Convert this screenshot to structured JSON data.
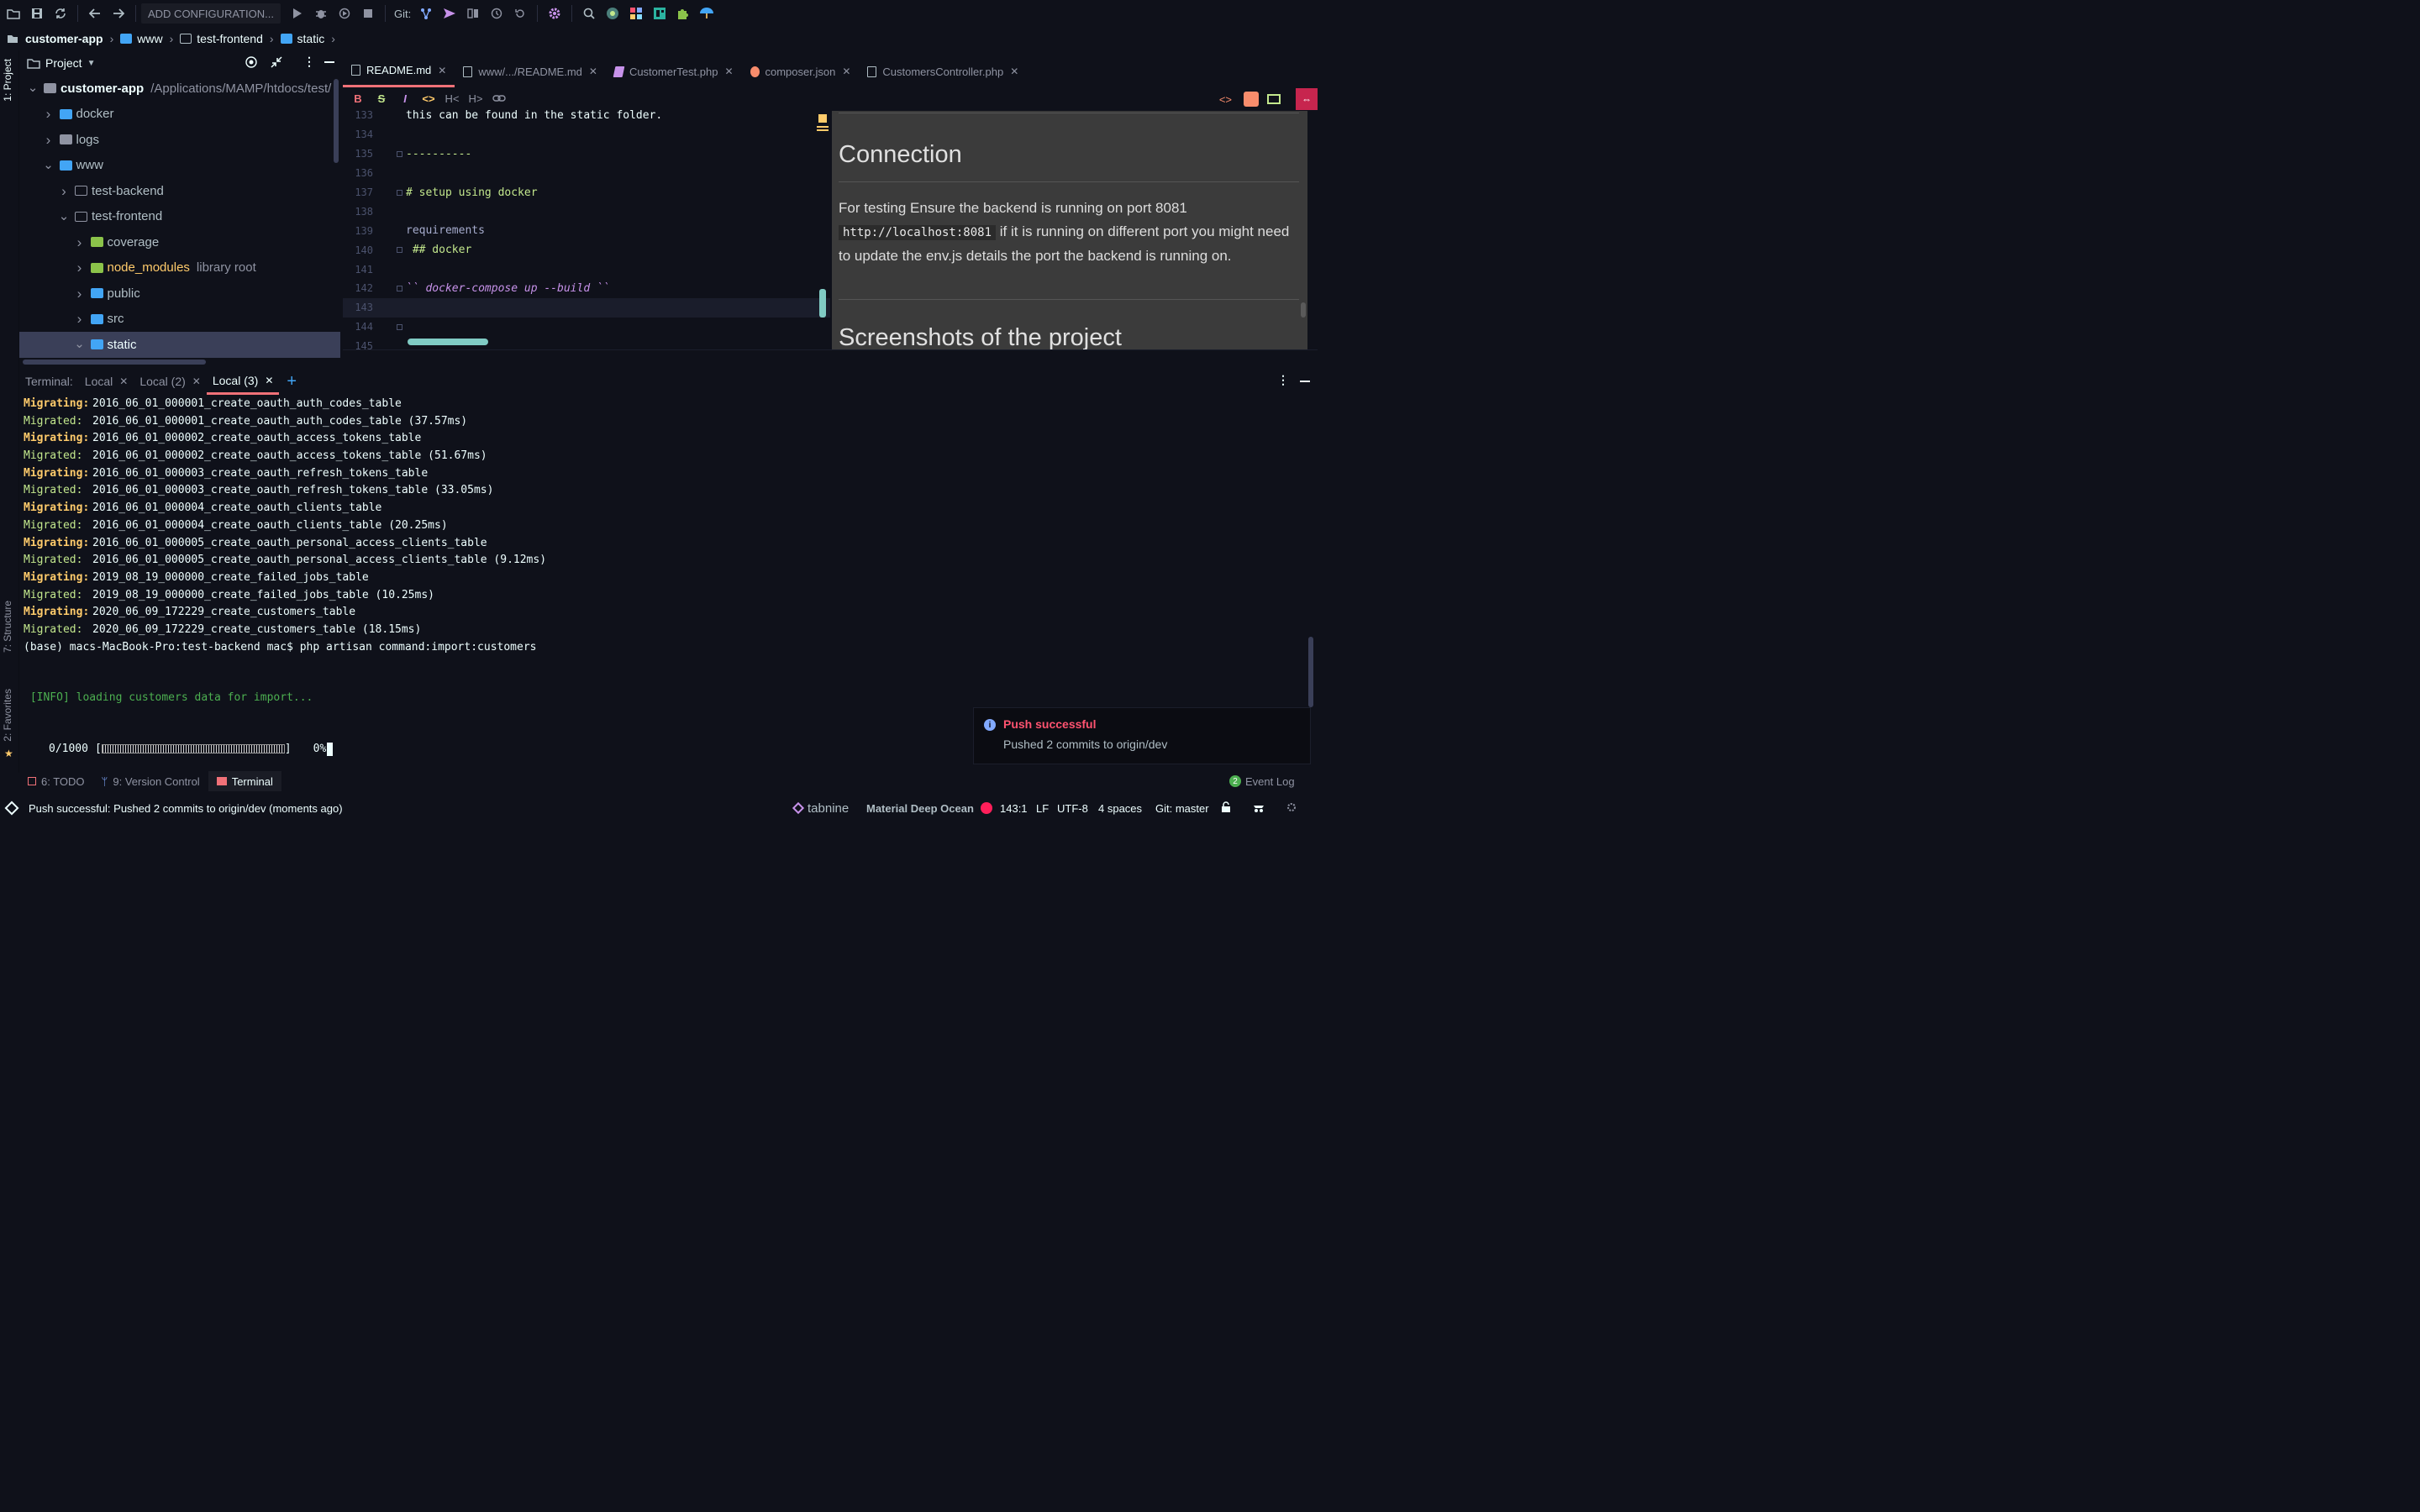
{
  "toolbar": {
    "add_config_label": "ADD CONFIGURATION...",
    "git_label": "Git:"
  },
  "breadcrumb": [
    "customer-app",
    "www",
    "test-frontend",
    "static"
  ],
  "sidebar_tabs": {
    "project": "1: Project",
    "structure": "7: Structure",
    "favorites": "2: Favorites"
  },
  "project": {
    "title": "Project",
    "tree": [
      {
        "label": "customer-app",
        "suffix": "/Applications/MAMP/htdocs/test/",
        "depth": 0,
        "expanded": true,
        "bold": true
      },
      {
        "label": "docker",
        "suffix": "",
        "depth": 1,
        "expanded": false
      },
      {
        "label": "logs",
        "suffix": "",
        "depth": 1,
        "expanded": false
      },
      {
        "label": "www",
        "suffix": "",
        "depth": 1,
        "expanded": true
      },
      {
        "label": "test-backend",
        "suffix": "",
        "depth": 2,
        "expanded": false
      },
      {
        "label": "test-frontend",
        "suffix": "",
        "depth": 2,
        "expanded": true
      },
      {
        "label": "coverage",
        "suffix": "",
        "depth": 3,
        "expanded": false
      },
      {
        "label": "node_modules",
        "suffix": "library root",
        "depth": 3,
        "expanded": false
      },
      {
        "label": "public",
        "suffix": "",
        "depth": 3,
        "expanded": false
      },
      {
        "label": "src",
        "suffix": "",
        "depth": 3,
        "expanded": false
      },
      {
        "label": "static",
        "suffix": "",
        "depth": 3,
        "expanded": true,
        "selected": true
      }
    ]
  },
  "editor_tabs": [
    {
      "label": "README.md",
      "active": true
    },
    {
      "label": "www/.../README.md",
      "active": false
    },
    {
      "label": "CustomerTest.php",
      "active": false
    },
    {
      "label": "composer.json",
      "active": false
    },
    {
      "label": "CustomersController.php",
      "active": false
    }
  ],
  "code": [
    {
      "n": "133",
      "text": "this can be found in the static folder."
    },
    {
      "n": "134",
      "text": ""
    },
    {
      "n": "135",
      "text": "----------"
    },
    {
      "n": "136",
      "text": ""
    },
    {
      "n": "137",
      "text": "# setup using docker"
    },
    {
      "n": "138",
      "text": ""
    },
    {
      "n": "139",
      "text": "requirements"
    },
    {
      "n": "140",
      "text": " ## docker"
    },
    {
      "n": "141",
      "text": ""
    },
    {
      "n": "142",
      "text": "`` docker-compose up --build ``"
    },
    {
      "n": "143",
      "text": ""
    },
    {
      "n": "144",
      "text": ""
    },
    {
      "n": "145",
      "text": ""
    }
  ],
  "preview": {
    "heading1": "Connection",
    "para_start": "For testing Ensure the backend is running on port 8081",
    "code": "http://localhost:8081",
    "para_end": "if it is running on different port you might need to update the env.js details the port the backend is running on.",
    "heading2": "Screenshots of the project"
  },
  "terminal": {
    "label": "Terminal:",
    "tabs": [
      "Local",
      "Local (2)",
      "Local (3)"
    ],
    "lines": [
      {
        "tag": "Migrating:",
        "text": "2016_06_01_000001_create_oauth_auth_codes_table"
      },
      {
        "tag": "Migrated:",
        "text": "2016_06_01_000001_create_oauth_auth_codes_table (37.57ms)"
      },
      {
        "tag": "Migrating:",
        "text": "2016_06_01_000002_create_oauth_access_tokens_table"
      },
      {
        "tag": "Migrated:",
        "text": "2016_06_01_000002_create_oauth_access_tokens_table (51.67ms)"
      },
      {
        "tag": "Migrating:",
        "text": "2016_06_01_000003_create_oauth_refresh_tokens_table"
      },
      {
        "tag": "Migrated:",
        "text": "2016_06_01_000003_create_oauth_refresh_tokens_table (33.05ms)"
      },
      {
        "tag": "Migrating:",
        "text": "2016_06_01_000004_create_oauth_clients_table"
      },
      {
        "tag": "Migrated:",
        "text": "2016_06_01_000004_create_oauth_clients_table (20.25ms)"
      },
      {
        "tag": "Migrating:",
        "text": "2016_06_01_000005_create_oauth_personal_access_clients_table"
      },
      {
        "tag": "Migrated:",
        "text": "2016_06_01_000005_create_oauth_personal_access_clients_table (9.12ms)"
      },
      {
        "tag": "Migrating:",
        "text": "2019_08_19_000000_create_failed_jobs_table"
      },
      {
        "tag": "Migrated:",
        "text": "2019_08_19_000000_create_failed_jobs_table (10.25ms)"
      },
      {
        "tag": "Migrating:",
        "text": "2020_06_09_172229_create_customers_table"
      },
      {
        "tag": "Migrated:",
        "text": "2020_06_09_172229_create_customers_table (18.15ms)"
      }
    ],
    "prompt": "(base) macs-MacBook-Pro:test-backend mac$ php artisan command:import:customers",
    "info": " [INFO] loading customers data for import...",
    "progress_count": "0/1000",
    "progress_percent": "0%",
    "progress_value": 0
  },
  "notification": {
    "title": "Push successful",
    "message": "Pushed 2 commits to origin/dev"
  },
  "tool_windows": [
    {
      "label": "6: TODO",
      "active": false
    },
    {
      "label": "9: Version Control",
      "active": false
    },
    {
      "label": "Terminal",
      "active": true
    }
  ],
  "event_log": {
    "count": "2",
    "label": "Event Log"
  },
  "status": {
    "message": "Push successful: Pushed 2 commits to origin/dev (moments ago)",
    "tabnine": "tabnine",
    "theme": "Material Deep Ocean",
    "position": "143:1",
    "line_sep": "LF",
    "encoding": "UTF-8",
    "indent": "4 spaces",
    "branch": "Git: master"
  },
  "colors": {
    "accent": "#f07178",
    "folder_blue": "#42a5f5",
    "folder_green": "#8bc34a",
    "terminal_yellow": "#ffcb6b",
    "terminal_green": "#c3e88d"
  }
}
